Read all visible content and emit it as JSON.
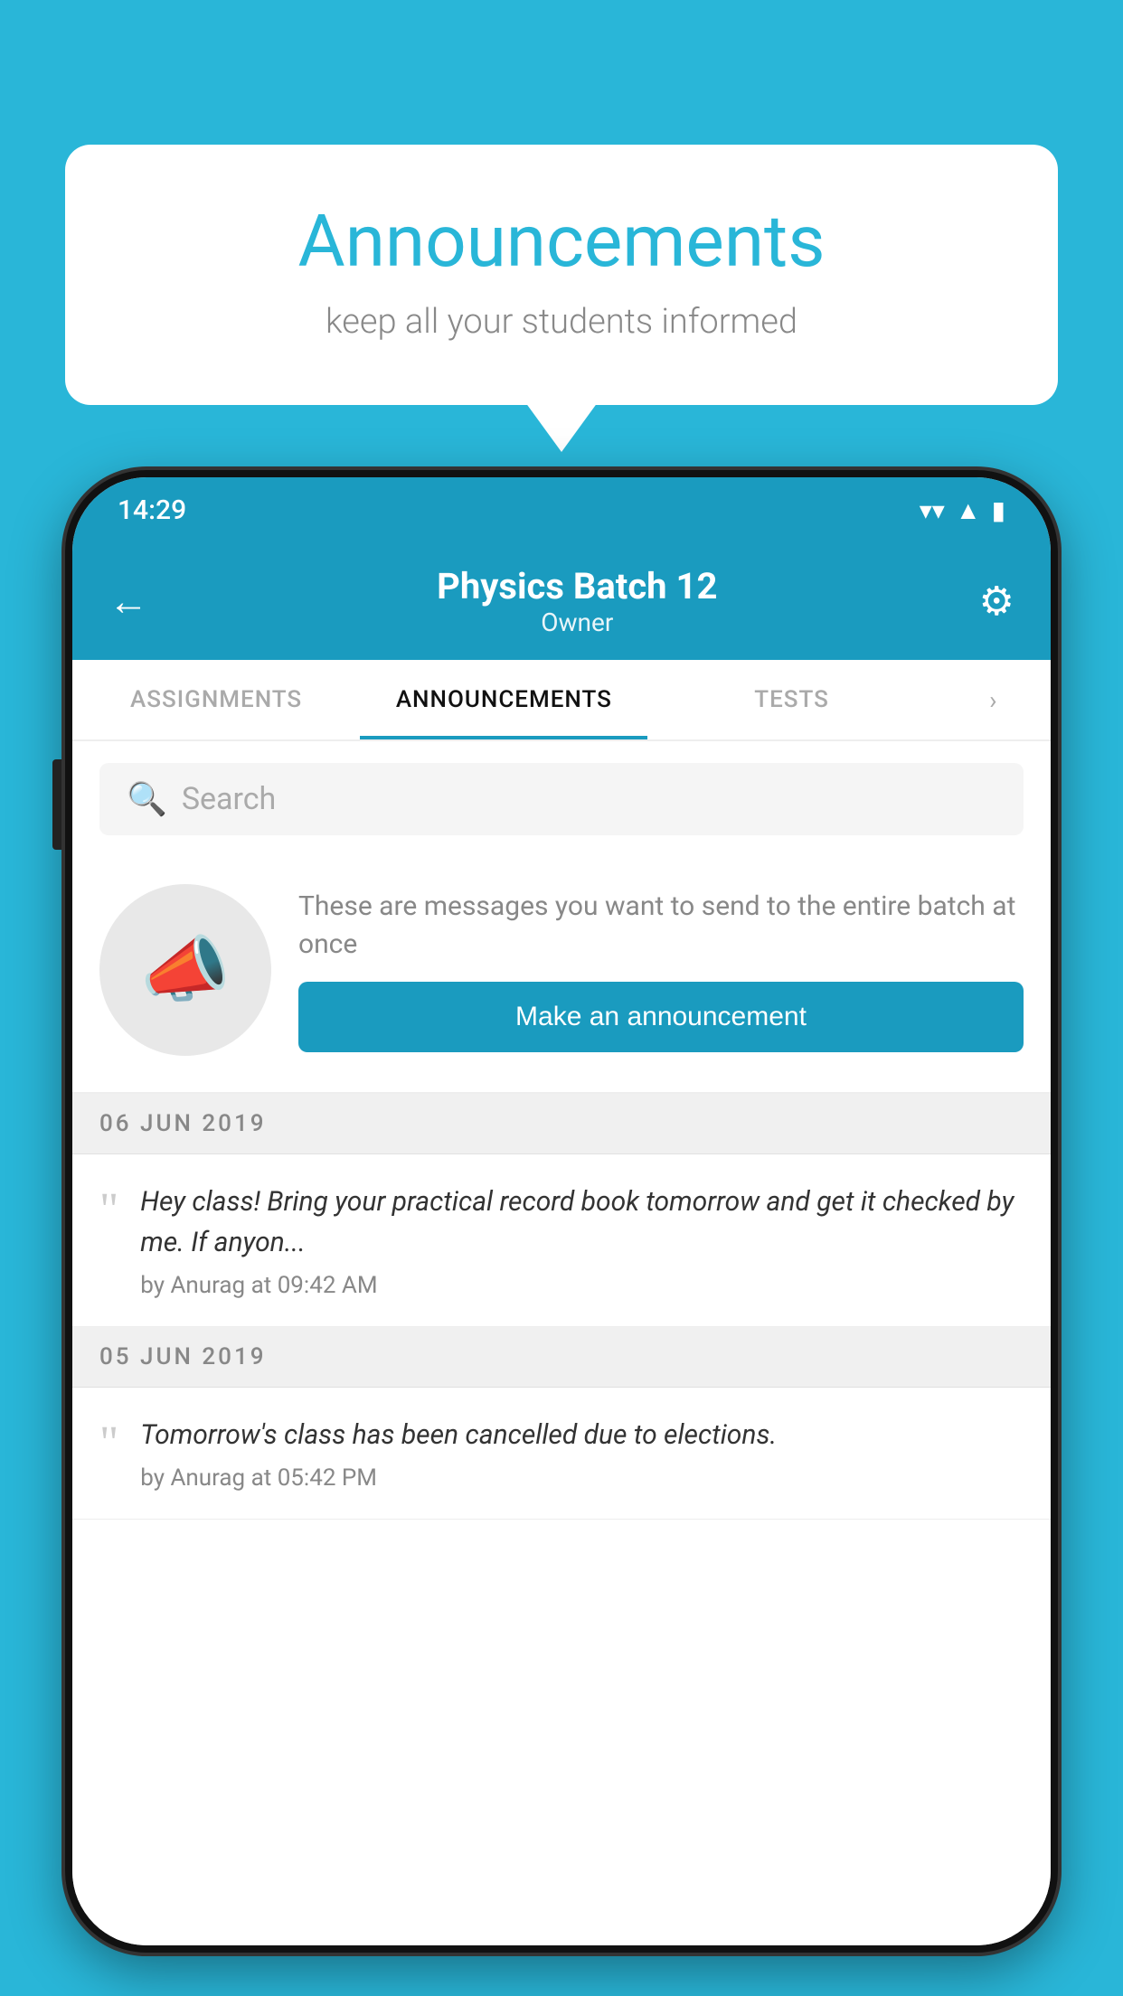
{
  "bubble": {
    "title": "Announcements",
    "subtitle": "keep all your students informed"
  },
  "phone": {
    "status_bar": {
      "time": "14:29",
      "wifi": "▲",
      "signal": "◀",
      "battery": "▮"
    },
    "app_bar": {
      "back_label": "←",
      "title": "Physics Batch 12",
      "subtitle": "Owner",
      "gear_label": "⚙"
    },
    "tabs": [
      {
        "label": "ASSIGNMENTS",
        "active": false
      },
      {
        "label": "ANNOUNCEMENTS",
        "active": true
      },
      {
        "label": "TESTS",
        "active": false
      }
    ],
    "search": {
      "placeholder": "Search"
    },
    "promo": {
      "description": "These are messages you want to send to the entire batch at once",
      "button_label": "Make an announcement"
    },
    "announcements": [
      {
        "date": "06  JUN  2019",
        "text": "Hey class! Bring your practical record book tomorrow and get it checked by me. If anyon...",
        "meta": "by Anurag at 09:42 AM"
      },
      {
        "date": "05  JUN  2019",
        "text": "Tomorrow's class has been cancelled due to elections.",
        "meta": "by Anurag at 05:42 PM"
      }
    ]
  }
}
